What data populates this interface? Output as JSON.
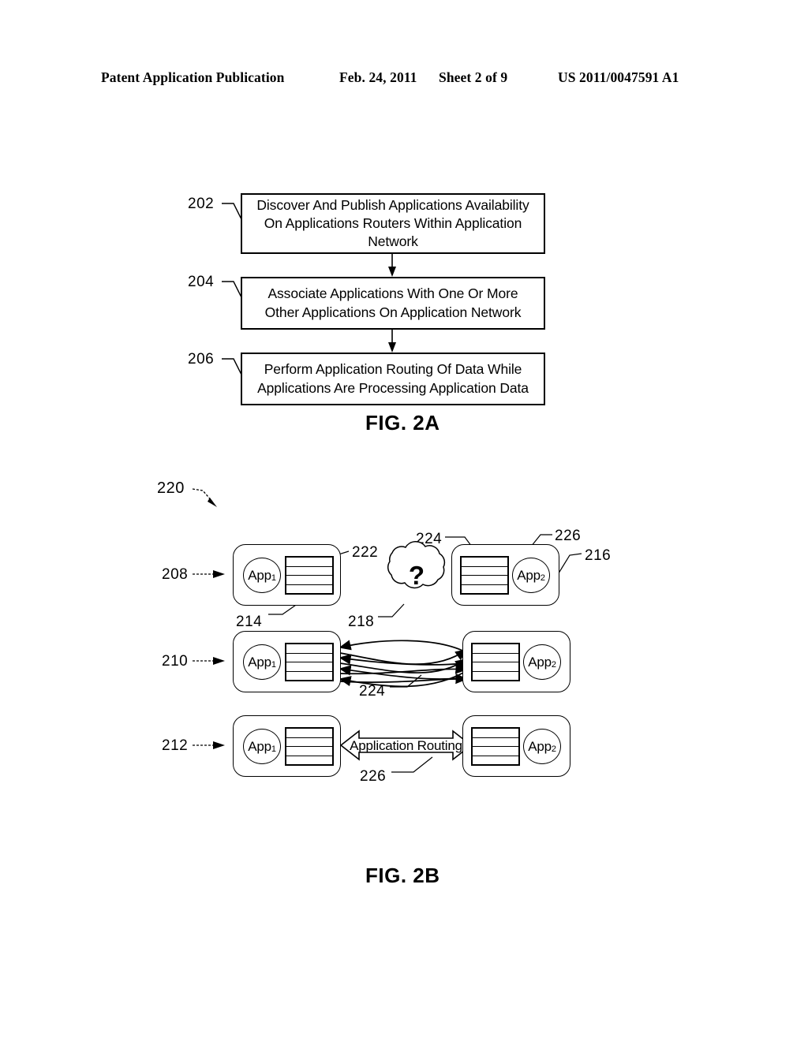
{
  "header": {
    "publication": "Patent Application Publication",
    "date": "Feb. 24, 2011",
    "sheet": "Sheet 2 of 9",
    "doc_number": "US 2011/0047591 A1"
  },
  "fig2a": {
    "label": "FIG. 2A",
    "steps": [
      {
        "ref": "202",
        "lines": [
          "Discover And Publish Applications Availability",
          "On Applications Routers Within Application",
          "Network"
        ]
      },
      {
        "ref": "204",
        "lines": [
          "Associate Applications With One Or More",
          "Other Applications On Application Network"
        ]
      },
      {
        "ref": "206",
        "lines": [
          "Perform Application Routing Of Data While",
          "Applications Are Processing Application Data"
        ]
      }
    ]
  },
  "fig2b": {
    "label": "FIG. 2B",
    "diagram_ref": "220",
    "rows": [
      {
        "ref": "208",
        "left_app": "App",
        "left_app_sub": "1",
        "right_app": "App",
        "right_app_sub": "2",
        "callouts": [
          "214",
          "222",
          "218",
          "224",
          "226",
          "216"
        ],
        "cloud_symbol": "?"
      },
      {
        "ref": "210",
        "left_app": "App",
        "left_app_sub": "1",
        "right_app": "App",
        "right_app_sub": "2",
        "callouts": [
          "224"
        ]
      },
      {
        "ref": "212",
        "left_app": "App",
        "left_app_sub": "1",
        "right_app": "App",
        "right_app_sub": "2",
        "arrow_label": "Application Routing",
        "callouts": [
          "226"
        ]
      }
    ]
  },
  "colors": {
    "ink": "#000000",
    "paper": "#ffffff"
  }
}
